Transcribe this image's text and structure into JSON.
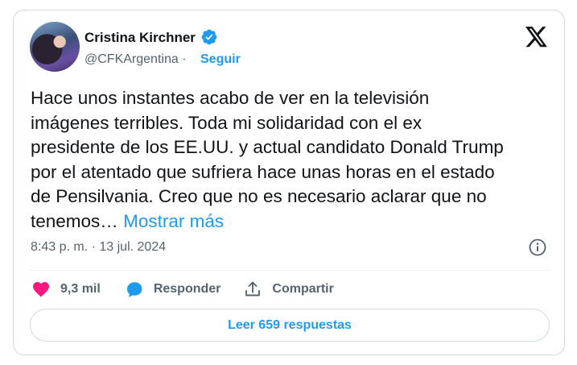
{
  "author": {
    "name": "Cristina Kirchner",
    "handle": "@CFKArgentina",
    "separator": "·",
    "follow_label": "Seguir",
    "verified_icon": "verified-badge-icon"
  },
  "brand_icon": "x-logo-icon",
  "tweet": {
    "text": "Hace unos instantes acabo de ver en la televisión\nimágenes terribles. Toda mi solidaridad con el ex\npresidente de los EE.UU. y actual candidato Donald Trump\npor el atentado que sufriera hace unas horas en el estado\nde Pensilvania. Creo que no es necesario aclarar que no\ntenemos…",
    "show_more_label": "Mostrar más",
    "timestamp": "8:43 p. m. · 13 jul. 2024"
  },
  "actions": {
    "like_count": "9,3 mil",
    "reply_label": "Responder",
    "share_label": "Compartir"
  },
  "replies_button": "Leer 659 respuestas",
  "colors": {
    "accent": "#1d9bf0",
    "like": "#f91880",
    "text": "#0f1419",
    "muted": "#536471",
    "border": "#cfd9de"
  }
}
